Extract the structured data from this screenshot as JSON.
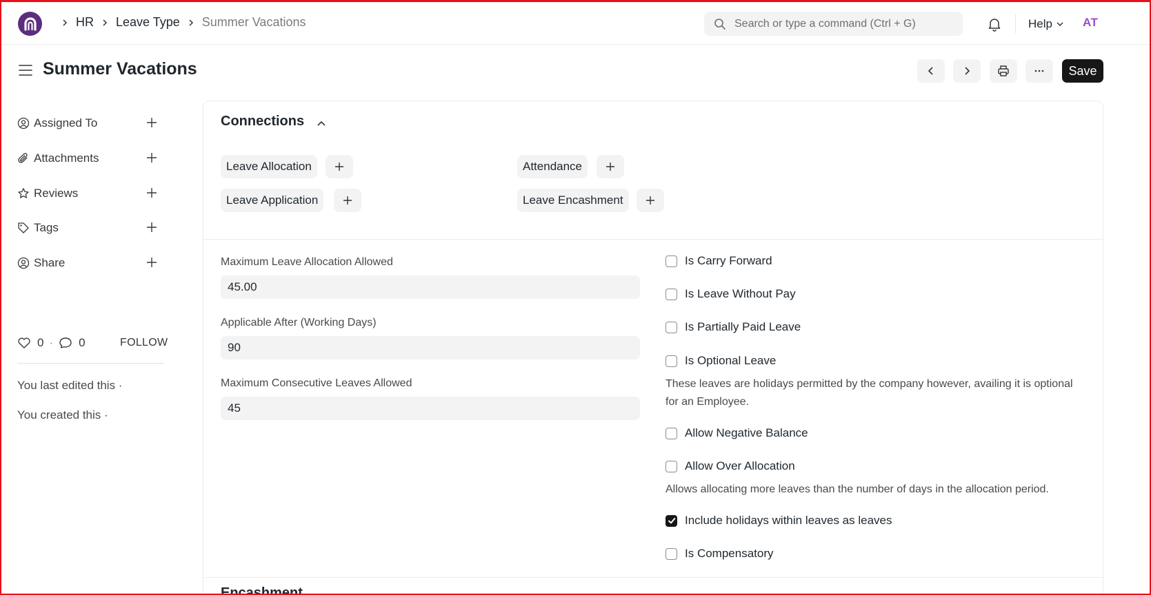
{
  "navbar": {
    "breadcrumbs": [
      "HR",
      "Leave Type",
      "Summer Vacations"
    ],
    "search_placeholder": "Search or type a command (Ctrl + G)",
    "help_label": "Help",
    "avatar_initials": "AT"
  },
  "page": {
    "title": "Summer Vacations",
    "save_label": "Save"
  },
  "sidebar": {
    "items": [
      {
        "label": "Assigned To",
        "icon": "user-plus-icon"
      },
      {
        "label": "Attachments",
        "icon": "paperclip-icon"
      },
      {
        "label": "Reviews",
        "icon": "star-icon"
      },
      {
        "label": "Tags",
        "icon": "tag-icon"
      },
      {
        "label": "Share",
        "icon": "share-user-icon"
      }
    ],
    "likes_count": "0",
    "comments_count": "0",
    "separator": "·",
    "follow_label": "FOLLOW",
    "last_edited": "You last edited this ·",
    "created": "You created this ·"
  },
  "connections": {
    "title": "Connections",
    "items": [
      "Leave Allocation",
      "Attendance",
      "Leave Application",
      "Leave Encashment"
    ]
  },
  "fields": {
    "max_allocation": {
      "label": "Maximum Leave Allocation Allowed",
      "value": "45.00"
    },
    "applicable_after": {
      "label": "Applicable After (Working Days)",
      "value": "90"
    },
    "max_consecutive": {
      "label": "Maximum Consecutive Leaves Allowed",
      "value": "45"
    }
  },
  "checkboxes": [
    {
      "label": "Is Carry Forward",
      "checked": false
    },
    {
      "label": "Is Leave Without Pay",
      "checked": false
    },
    {
      "label": "Is Partially Paid Leave",
      "checked": false
    },
    {
      "label": "Is Optional Leave",
      "checked": false
    },
    {
      "label": "Allow Negative Balance",
      "checked": false
    },
    {
      "label": "Allow Over Allocation",
      "checked": false
    },
    {
      "label": "Include holidays within leaves as leaves",
      "checked": true
    },
    {
      "label": "Is Compensatory",
      "checked": false
    }
  ],
  "descriptions": {
    "optional_leave": "These leaves are holidays permitted by the company however, availing it is optional for an Employee.",
    "over_allocation": "Allows allocating more leaves than the number of days in the allocation period."
  },
  "next_section_title": "Encashment",
  "colors": {
    "accent": "#171717",
    "brand": "#5c2d7e",
    "avatar": "#9b4dca",
    "frame": "#e8101c"
  }
}
